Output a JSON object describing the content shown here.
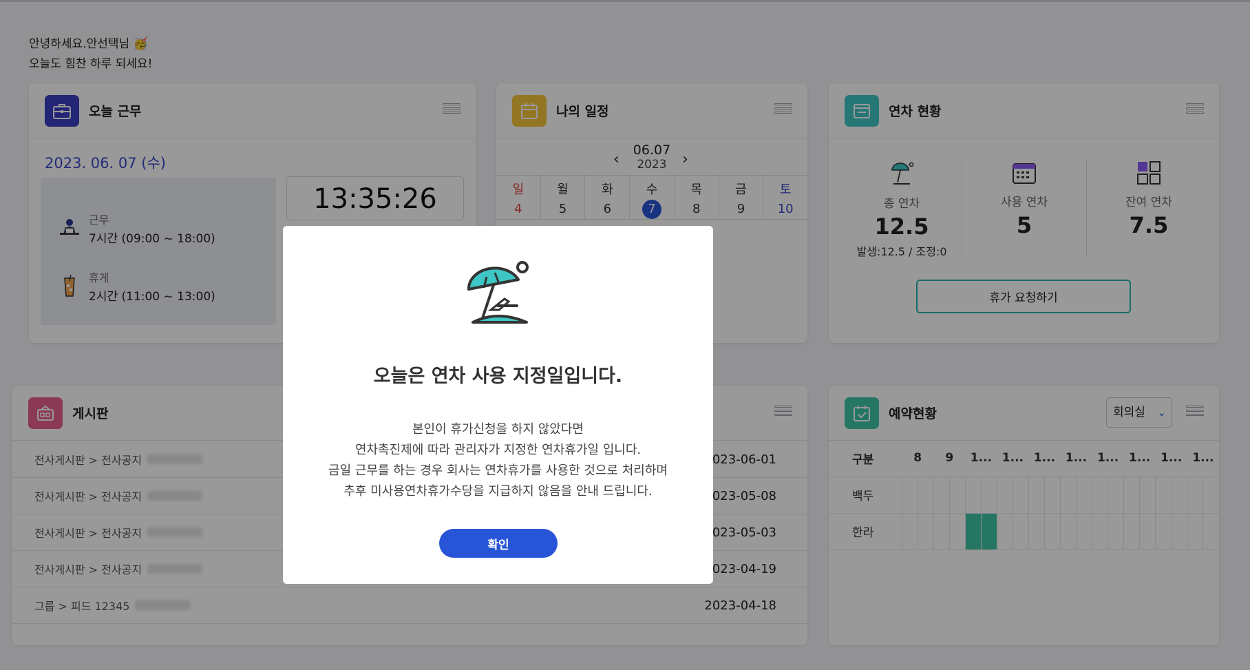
{
  "greeting": {
    "line1": "안녕하세요.안선택님 🥳",
    "line2": "오늘도 힘찬 하루 되세요!"
  },
  "today_work": {
    "title": "오늘 근무",
    "date": "2023. 06. 07 (수)",
    "clock": "13:35:26",
    "work_label": "근무",
    "work_value": "7시간 (09:00 ~ 18:00)",
    "break_label": "휴게",
    "break_value": "2시간 (11:00 ~ 13:00)"
  },
  "schedule": {
    "title": "나의 일정",
    "month_day": "06.07",
    "year": "2023",
    "prev": "‹",
    "next": "›",
    "days": [
      {
        "name": "일",
        "num": "4"
      },
      {
        "name": "월",
        "num": "5"
      },
      {
        "name": "화",
        "num": "6"
      },
      {
        "name": "수",
        "num": "7"
      },
      {
        "name": "목",
        "num": "8"
      },
      {
        "name": "금",
        "num": "9"
      },
      {
        "name": "토",
        "num": "10"
      }
    ]
  },
  "leave": {
    "title": "연차 현황",
    "total_label": "총 연차",
    "total_value": "12.5",
    "total_sub": "발생:12.5 / 조정:0",
    "used_label": "사용 연차",
    "used_value": "5",
    "remain_label": "잔여 연차",
    "remain_value": "7.5",
    "request_button": "휴가 요청하기"
  },
  "board": {
    "title": "게시판",
    "rows": [
      {
        "path": "전사게시판 > 전사공지",
        "date": "2023-06-01"
      },
      {
        "path": "전사게시판 > 전사공지",
        "date": "2023-05-08"
      },
      {
        "path": "전사게시판 > 전사공지",
        "date": "2023-05-03"
      },
      {
        "path": "전사게시판 > 전사공지",
        "date": "2023-04-19"
      },
      {
        "path": "그룹 > 피드 12345",
        "date": "2023-04-18"
      }
    ]
  },
  "reservation": {
    "title": "예약현황",
    "select_value": "회의실",
    "header_label": "구분",
    "hours": [
      "8",
      "9",
      "1...",
      "1...",
      "1...",
      "1...",
      "1...",
      "1...",
      "1...",
      "1..."
    ],
    "rooms": [
      {
        "name": "백두",
        "booked_cells": []
      },
      {
        "name": "한라",
        "booked_cells": [
          4,
          5
        ]
      }
    ]
  },
  "modal": {
    "title": "오늘은 연차 사용 지정일입니다.",
    "body": [
      "본인이 휴가신청을 하지 않았다면",
      "연차촉진제에 따라 관리자가 지정한 연차휴가일 입니다.",
      "금일 근무를 하는 경우 회사는 연차휴가를 사용한 것으로 처리하며",
      "추후 미사용연차휴가수당을 지급하지 않음을 안내 드립니다."
    ],
    "confirm_button": "확인"
  },
  "colors": {
    "work_icon": "#3b3fc4",
    "schedule_icon": "#f5c53b",
    "leave_icon": "#3ec6c4",
    "board_icon": "#e8608d",
    "reservation_icon": "#3ec6a7",
    "primary": "#2855d8"
  },
  "icons": {
    "work": "briefcase-icon",
    "schedule": "calendar-icon",
    "leave": "window-icon",
    "board": "board-icon",
    "reservation": "calendar-check-icon",
    "modal": "beach-umbrella-icon"
  }
}
